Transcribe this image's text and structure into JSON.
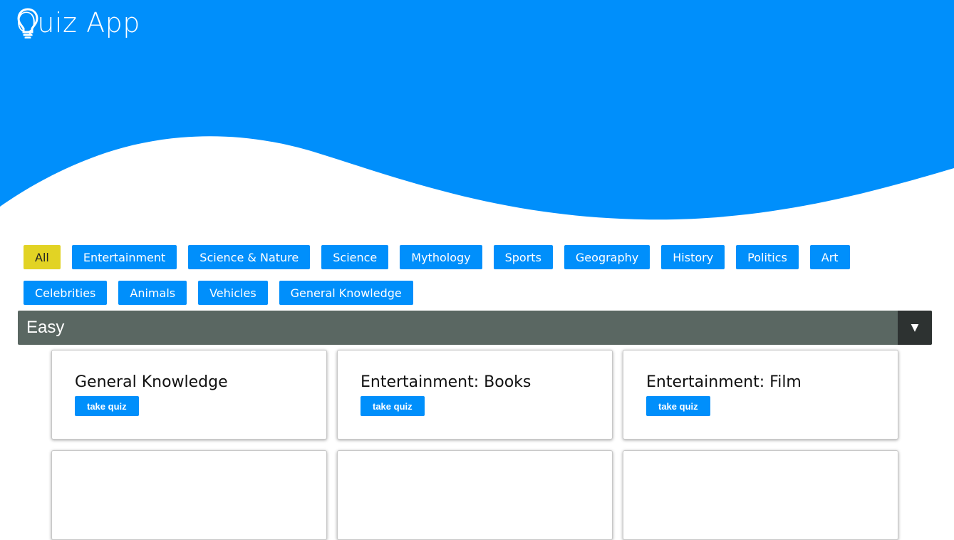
{
  "app": {
    "title": "Quiz App",
    "icon": "lightbulb-icon"
  },
  "colors": {
    "primary": "#008ffb",
    "active_filter": "#e2d324",
    "select_bg": "#5a6762",
    "select_arrow_bg": "#2d3231"
  },
  "filters": [
    {
      "label": "All",
      "active": true
    },
    {
      "label": "Entertainment",
      "active": false
    },
    {
      "label": "Science & Nature",
      "active": false
    },
    {
      "label": "Science",
      "active": false
    },
    {
      "label": "Mythology",
      "active": false
    },
    {
      "label": "Sports",
      "active": false
    },
    {
      "label": "Geography",
      "active": false
    },
    {
      "label": "History",
      "active": false
    },
    {
      "label": "Politics",
      "active": false
    },
    {
      "label": "Art",
      "active": false
    },
    {
      "label": "Celebrities",
      "active": false
    },
    {
      "label": "Animals",
      "active": false
    },
    {
      "label": "Vehicles",
      "active": false
    },
    {
      "label": "General Knowledge",
      "active": false
    }
  ],
  "difficulty": {
    "selected": "Easy",
    "arrow_icon": "triangle-down-icon"
  },
  "quizzes": [
    {
      "title": "General Knowledge",
      "button": "take quiz"
    },
    {
      "title": "Entertainment: Books",
      "button": "take quiz"
    },
    {
      "title": "Entertainment: Film",
      "button": "take quiz"
    },
    {
      "title": "",
      "button": ""
    },
    {
      "title": "",
      "button": ""
    },
    {
      "title": "",
      "button": ""
    }
  ]
}
